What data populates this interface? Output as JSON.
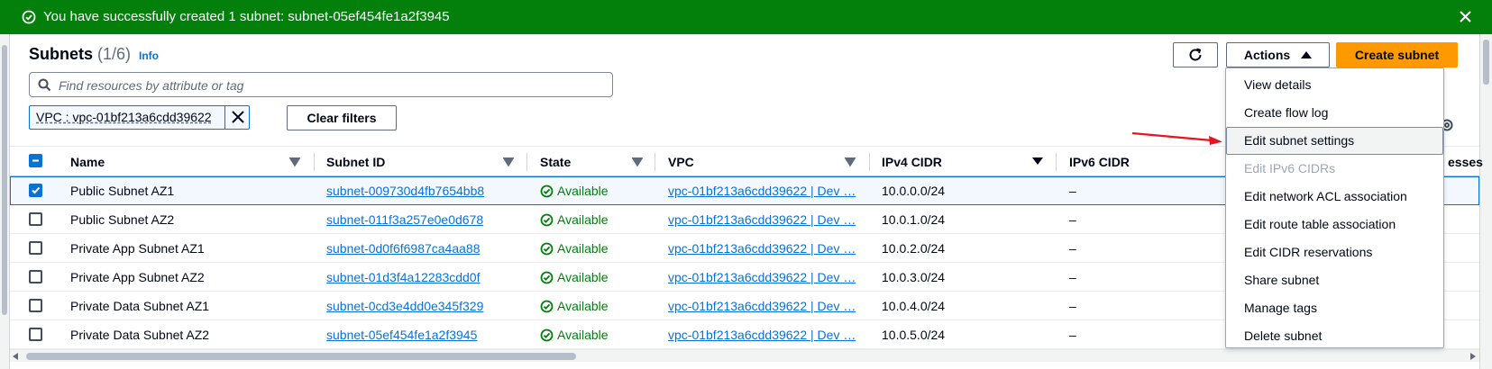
{
  "banner": {
    "message": "You have successfully created 1 subnet: subnet-05ef454fe1a2f3945",
    "color": "#037f0c"
  },
  "header": {
    "title": "Subnets",
    "count": "(1/6)",
    "info": "Info"
  },
  "search": {
    "placeholder": "Find resources by attribute or tag"
  },
  "filter_chip": {
    "label": "VPC : vpc-01bf213a6cdd39622"
  },
  "buttons": {
    "clear_filters": "Clear filters",
    "actions": "Actions",
    "create_subnet": "Create subnet"
  },
  "columns": [
    "Name",
    "Subnet ID",
    "State",
    "VPC",
    "IPv4 CIDR",
    "IPv6 CIDR"
  ],
  "rows": [
    {
      "name": "Public Subnet AZ1",
      "subnet_id": "subnet-009730d4fb7654bb8",
      "state": "Available",
      "vpc": "vpc-01bf213a6cdd39622 | Dev …",
      "ipv4": "10.0.0.0/24",
      "ipv6": "–",
      "selected": true
    },
    {
      "name": "Public Subnet AZ2",
      "subnet_id": "subnet-011f3a257e0e0d678",
      "state": "Available",
      "vpc": "vpc-01bf213a6cdd39622 | Dev …",
      "ipv4": "10.0.1.0/24",
      "ipv6": "–",
      "selected": false
    },
    {
      "name": "Private App Subnet AZ1",
      "subnet_id": "subnet-0d0f6f6987ca4aa88",
      "state": "Available",
      "vpc": "vpc-01bf213a6cdd39622 | Dev …",
      "ipv4": "10.0.2.0/24",
      "ipv6": "–",
      "selected": false
    },
    {
      "name": "Private App Subnet AZ2",
      "subnet_id": "subnet-01d3f4a12283cdd0f",
      "state": "Available",
      "vpc": "vpc-01bf213a6cdd39622 | Dev …",
      "ipv4": "10.0.3.0/24",
      "ipv6": "–",
      "selected": false
    },
    {
      "name": "Private Data Subnet AZ1",
      "subnet_id": "subnet-0cd3e4dd0e345f329",
      "state": "Available",
      "vpc": "vpc-01bf213a6cdd39622 | Dev …",
      "ipv4": "10.0.4.0/24",
      "ipv6": "–",
      "selected": false
    },
    {
      "name": "Private Data Subnet AZ2",
      "subnet_id": "subnet-05ef454fe1a2f3945",
      "state": "Available",
      "vpc": "vpc-01bf213a6cdd39622 | Dev …",
      "ipv4": "10.0.5.0/24",
      "ipv6": "–",
      "selected": false
    }
  ],
  "actions_menu": {
    "items": [
      {
        "label": "View details",
        "disabled": false
      },
      {
        "label": "Create flow log",
        "disabled": false
      },
      {
        "label": "Edit subnet settings",
        "disabled": false,
        "hovered": true
      },
      {
        "label": "Edit IPv6 CIDRs",
        "disabled": true
      },
      {
        "label": "Edit network ACL association",
        "disabled": false
      },
      {
        "label": "Edit route table association",
        "disabled": false
      },
      {
        "label": "Edit CIDR reservations",
        "disabled": false
      },
      {
        "label": "Share subnet",
        "disabled": false
      },
      {
        "label": "Manage tags",
        "disabled": false
      },
      {
        "label": "Delete subnet",
        "disabled": false
      }
    ]
  },
  "partial_column_label": "esses",
  "colors": {
    "accent": "#0972d3",
    "primary_button": "#ff9900",
    "success": "#037f0c",
    "annotation_arrow": "#e8141b"
  }
}
